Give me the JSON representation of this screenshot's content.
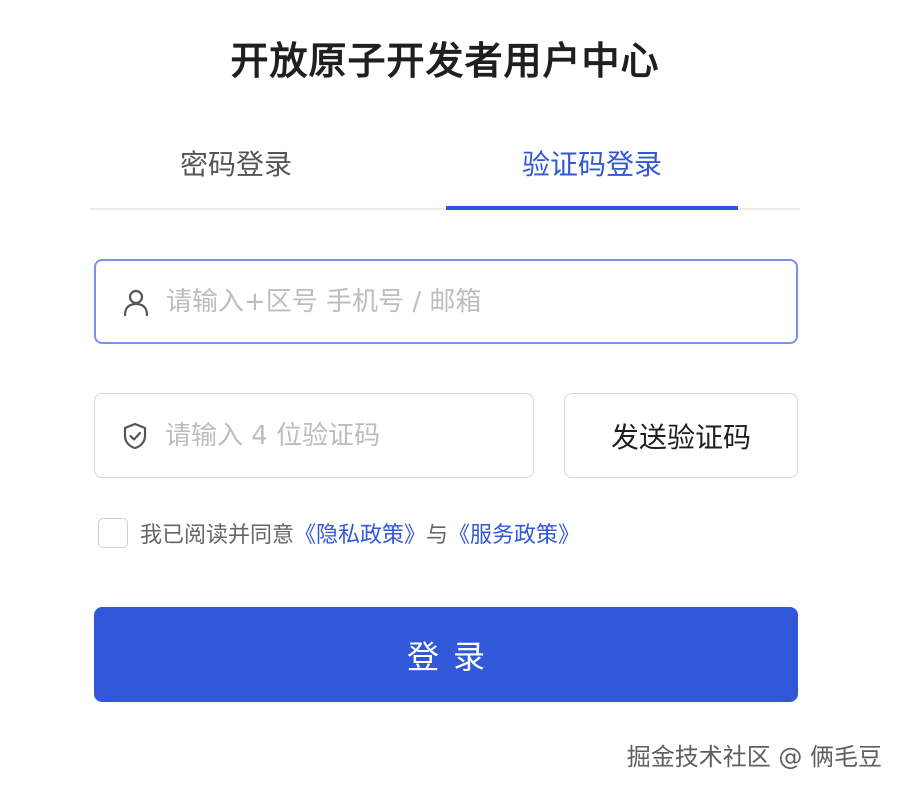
{
  "page": {
    "title": "开放原子开发者用户中心"
  },
  "tabs": [
    {
      "label": "密码登录",
      "active": false
    },
    {
      "label": "验证码登录",
      "active": true
    }
  ],
  "phone_field": {
    "placeholder": "请输入+区号 手机号 / 邮箱",
    "value": "",
    "icon": "user-icon"
  },
  "code_field": {
    "placeholder": "请输入 4 位验证码",
    "value": "",
    "icon": "shield-check-icon"
  },
  "send_code_button": {
    "label": "发送验证码"
  },
  "agreement": {
    "checked": false,
    "prefix": "我已阅读并同意",
    "privacy_link": "《隐私政策》",
    "connector": "与",
    "service_link": "《服务政策》"
  },
  "login_button": {
    "label": "登录"
  },
  "watermark": {
    "text": "掘金技术社区 @ 俩毛豆"
  },
  "colors": {
    "accent": "#3158d9",
    "active_tab": "#3158d6",
    "focus_border": "#7594e8"
  }
}
